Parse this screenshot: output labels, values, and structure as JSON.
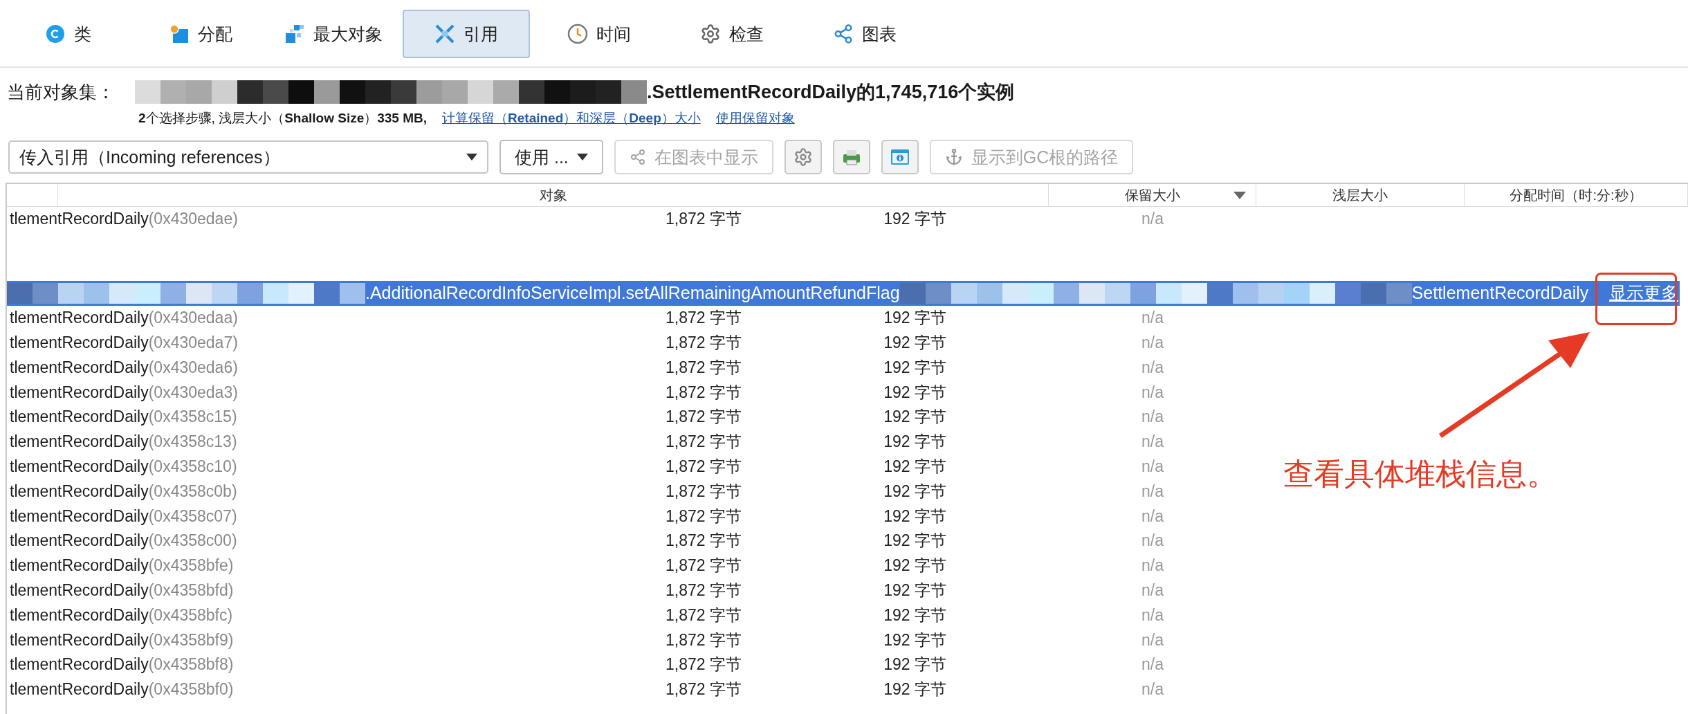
{
  "tabs": [
    {
      "label": "类",
      "selected": false
    },
    {
      "label": "分配",
      "selected": false
    },
    {
      "label": "最大对象",
      "selected": false
    },
    {
      "label": "引用",
      "selected": true
    },
    {
      "label": "时间",
      "selected": false
    },
    {
      "label": "检查",
      "selected": false
    },
    {
      "label": "图表",
      "selected": false
    }
  ],
  "current_set": {
    "label": "当前对象集：",
    "title": ".SettlementRecordDaily的1,745,716个实例",
    "summary": "**2**个选择步骤, 浅层大小（**Shallow Size**）**335 MB,**",
    "links": [
      "计算保留（**Retained**）和深层（**Deep**）大小",
      "使用保留对象"
    ]
  },
  "toolbar": {
    "reference_select": {
      "value": "传入引用（Incoming references）"
    },
    "use_button": {
      "label": "使用 ...",
      "disabled": false
    },
    "graph_button": {
      "label": "在图表中显示",
      "disabled": true
    },
    "gc_button": {
      "label": "显示到GC根的路径",
      "disabled": true
    }
  },
  "table": {
    "columns": [
      {
        "label": "对象",
        "sorted": false
      },
      {
        "label": "保留大小",
        "sorted": true
      },
      {
        "label": "浅层大小",
        "sorted": false
      },
      {
        "label": "分配时间（时:分:秒）",
        "sorted": false
      }
    ],
    "rows": [
      {
        "kind": "object",
        "selected": false,
        "class_name": "tlementRecordDaily",
        "address": "(0x430edae)",
        "cells": [
          "1,872 字节",
          "192 字节",
          "n/a"
        ]
      },
      {
        "kind": "blank"
      },
      {
        "kind": "stack",
        "selected": true,
        "method": ".AdditionalRecordInfoServiceImpl.setAllRemainingAmountRefundFlag",
        "class_name": "SettlementRecordDaily",
        "link": "显示更多"
      },
      {
        "kind": "object",
        "selected": false,
        "class_name": "tlementRecordDaily",
        "address": "(0x430edaa)",
        "cells": [
          "1,872 字节",
          "192 字节",
          "n/a"
        ]
      },
      {
        "kind": "object",
        "selected": false,
        "class_name": "tlementRecordDaily",
        "address": "(0x430eda7)",
        "cells": [
          "1,872 字节",
          "192 字节",
          "n/a"
        ]
      },
      {
        "kind": "object",
        "selected": false,
        "class_name": "tlementRecordDaily",
        "address": "(0x430eda6)",
        "cells": [
          "1,872 字节",
          "192 字节",
          "n/a"
        ]
      },
      {
        "kind": "object",
        "selected": false,
        "class_name": "tlementRecordDaily",
        "address": "(0x430eda3)",
        "cells": [
          "1,872 字节",
          "192 字节",
          "n/a"
        ]
      },
      {
        "kind": "object",
        "selected": false,
        "class_name": "tlementRecordDaily",
        "address": "(0x4358c15)",
        "cells": [
          "1,872 字节",
          "192 字节",
          "n/a"
        ]
      },
      {
        "kind": "object",
        "selected": false,
        "class_name": "tlementRecordDaily",
        "address": "(0x4358c13)",
        "cells": [
          "1,872 字节",
          "192 字节",
          "n/a"
        ]
      },
      {
        "kind": "object",
        "selected": false,
        "class_name": "tlementRecordDaily",
        "address": "(0x4358c10)",
        "cells": [
          "1,872 字节",
          "192 字节",
          "n/a"
        ]
      },
      {
        "kind": "object",
        "selected": false,
        "class_name": "tlementRecordDaily",
        "address": "(0x4358c0b)",
        "cells": [
          "1,872 字节",
          "192 字节",
          "n/a"
        ]
      },
      {
        "kind": "object",
        "selected": false,
        "class_name": "tlementRecordDaily",
        "address": "(0x4358c07)",
        "cells": [
          "1,872 字节",
          "192 字节",
          "n/a"
        ]
      },
      {
        "kind": "object",
        "selected": false,
        "class_name": "tlementRecordDaily",
        "address": "(0x4358c00)",
        "cells": [
          "1,872 字节",
          "192 字节",
          "n/a"
        ]
      },
      {
        "kind": "object",
        "selected": false,
        "class_name": "tlementRecordDaily",
        "address": "(0x4358bfe)",
        "cells": [
          "1,872 字节",
          "192 字节",
          "n/a"
        ]
      },
      {
        "kind": "object",
        "selected": false,
        "class_name": "tlementRecordDaily",
        "address": "(0x4358bfd)",
        "cells": [
          "1,872 字节",
          "192 字节",
          "n/a"
        ]
      },
      {
        "kind": "object",
        "selected": false,
        "class_name": "tlementRecordDaily",
        "address": "(0x4358bfc)",
        "cells": [
          "1,872 字节",
          "192 字节",
          "n/a"
        ]
      },
      {
        "kind": "object",
        "selected": false,
        "class_name": "tlementRecordDaily",
        "address": "(0x4358bf9)",
        "cells": [
          "1,872 字节",
          "192 字节",
          "n/a"
        ]
      },
      {
        "kind": "object",
        "selected": false,
        "class_name": "tlementRecordDaily",
        "address": "(0x4358bf8)",
        "cells": [
          "1,872 字节",
          "192 字节",
          "n/a"
        ]
      },
      {
        "kind": "object",
        "selected": false,
        "class_name": "tlementRecordDaily",
        "address": "(0x4358bf0)",
        "cells": [
          "1,872 字节",
          "192 字节",
          "n/a"
        ]
      }
    ]
  },
  "annotation": {
    "text": "查看具体堆栈信息。"
  }
}
